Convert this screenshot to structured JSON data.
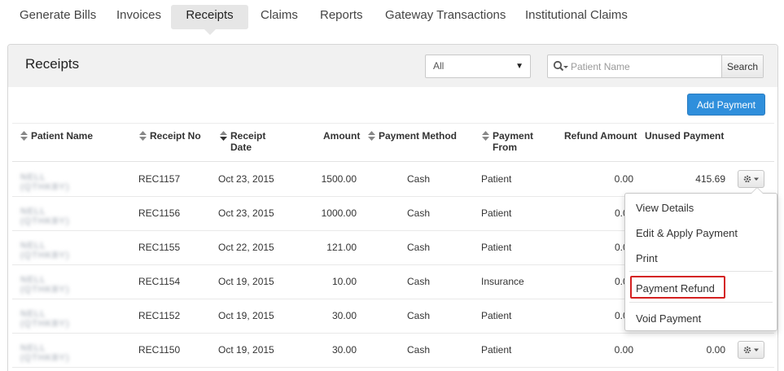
{
  "nav": {
    "tabs": [
      {
        "label": "Generate Bills"
      },
      {
        "label": "Invoices"
      },
      {
        "label": "Receipts"
      },
      {
        "label": "Claims"
      },
      {
        "label": "Reports"
      },
      {
        "label": "Gateway Transactions"
      },
      {
        "label": "Institutional Claims"
      }
    ],
    "active_tab": "Receipts"
  },
  "panel": {
    "title": "Receipts",
    "filter": {
      "selected": "All"
    },
    "search": {
      "placeholder": "Patient Name",
      "value": "",
      "button_label": "Search"
    },
    "add_button_label": "Add Payment"
  },
  "table": {
    "headers": {
      "patient_name": "Patient Name",
      "receipt_no": "Receipt No",
      "receipt_date_1": "Receipt",
      "receipt_date_2": "Date",
      "amount": "Amount",
      "payment_method": "Payment Method",
      "payment_from_1": "Payment",
      "payment_from_2": "From",
      "refund_amount": "Refund Amount",
      "unused_payment": "Unused Payment"
    },
    "rows": [
      {
        "patient": "NELL (QTHKBY)",
        "receipt_no": "REC1157",
        "date": "Oct 23, 2015",
        "amount": "1500.00",
        "method": "Cash",
        "from": "Patient",
        "refund": "0.00",
        "unused": "415.69"
      },
      {
        "patient": "NELL (QTHKBY)",
        "receipt_no": "REC1156",
        "date": "Oct 23, 2015",
        "amount": "1000.00",
        "method": "Cash",
        "from": "Patient",
        "refund": "0.0",
        "unused": ""
      },
      {
        "patient": "NELL (QTHKBY)",
        "receipt_no": "REC1155",
        "date": "Oct 22, 2015",
        "amount": "121.00",
        "method": "Cash",
        "from": "Patient",
        "refund": "0.0",
        "unused": ""
      },
      {
        "patient": "NELL (QTHKBY)",
        "receipt_no": "REC1154",
        "date": "Oct 19, 2015",
        "amount": "10.00",
        "method": "Cash",
        "from": "Insurance",
        "refund": "0.0",
        "unused": ""
      },
      {
        "patient": "NELL (QTHKBY)",
        "receipt_no": "REC1152",
        "date": "Oct 19, 2015",
        "amount": "30.00",
        "method": "Cash",
        "from": "Patient",
        "refund": "0.0",
        "unused": ""
      },
      {
        "patient": "NELL (QTHKBY)",
        "receipt_no": "REC1150",
        "date": "Oct 19, 2015",
        "amount": "30.00",
        "method": "Cash",
        "from": "Patient",
        "refund": "0.00",
        "unused": "0.00"
      }
    ]
  },
  "row_menu": {
    "items": [
      {
        "label": "View Details"
      },
      {
        "label": "Edit & Apply Payment"
      },
      {
        "label": "Print"
      },
      {
        "label": "Payment Refund"
      },
      {
        "label": "Void Payment"
      }
    ],
    "highlighted": "Payment Refund"
  },
  "colors": {
    "accent": "#2f8fdc",
    "highlight_border": "#d42020",
    "header_bg": "#f1f1f1"
  },
  "icons": {
    "search": "search-dropdown-icon",
    "gear": "gear-icon",
    "sort": "sort-icon",
    "select_caret": "caret-down-icon"
  }
}
